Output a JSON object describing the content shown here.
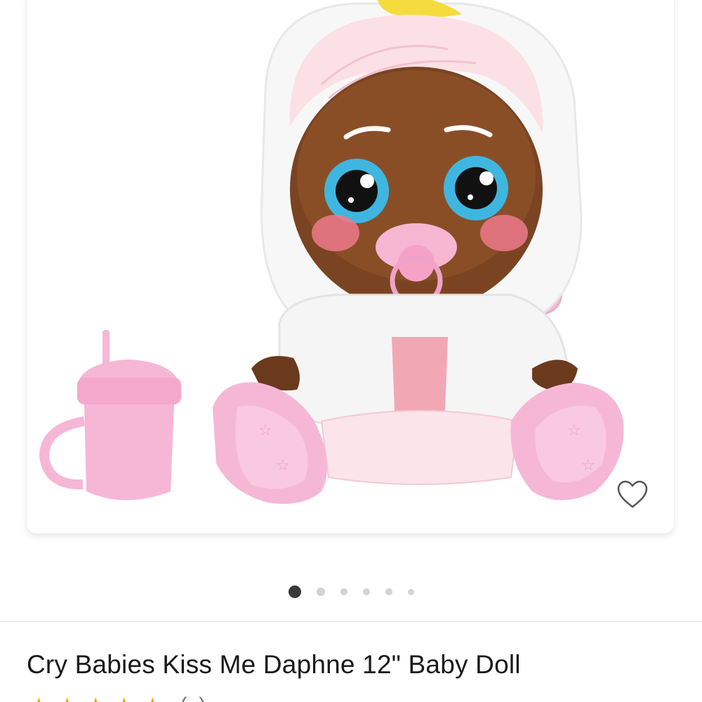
{
  "product": {
    "title": "Cry Babies Kiss Me Daphne 12\" Baby Doll",
    "rating_count": "(..)",
    "rating_stars": 5
  },
  "gallery": {
    "image_count": 6,
    "active_index": 0
  },
  "icons": {
    "wishlist": "heart-outline-icon",
    "star": "star-icon"
  },
  "colors": {
    "dot_active": "#3a3a3a",
    "dot_inactive": "#d4d4d4",
    "star": "#f0a400"
  }
}
